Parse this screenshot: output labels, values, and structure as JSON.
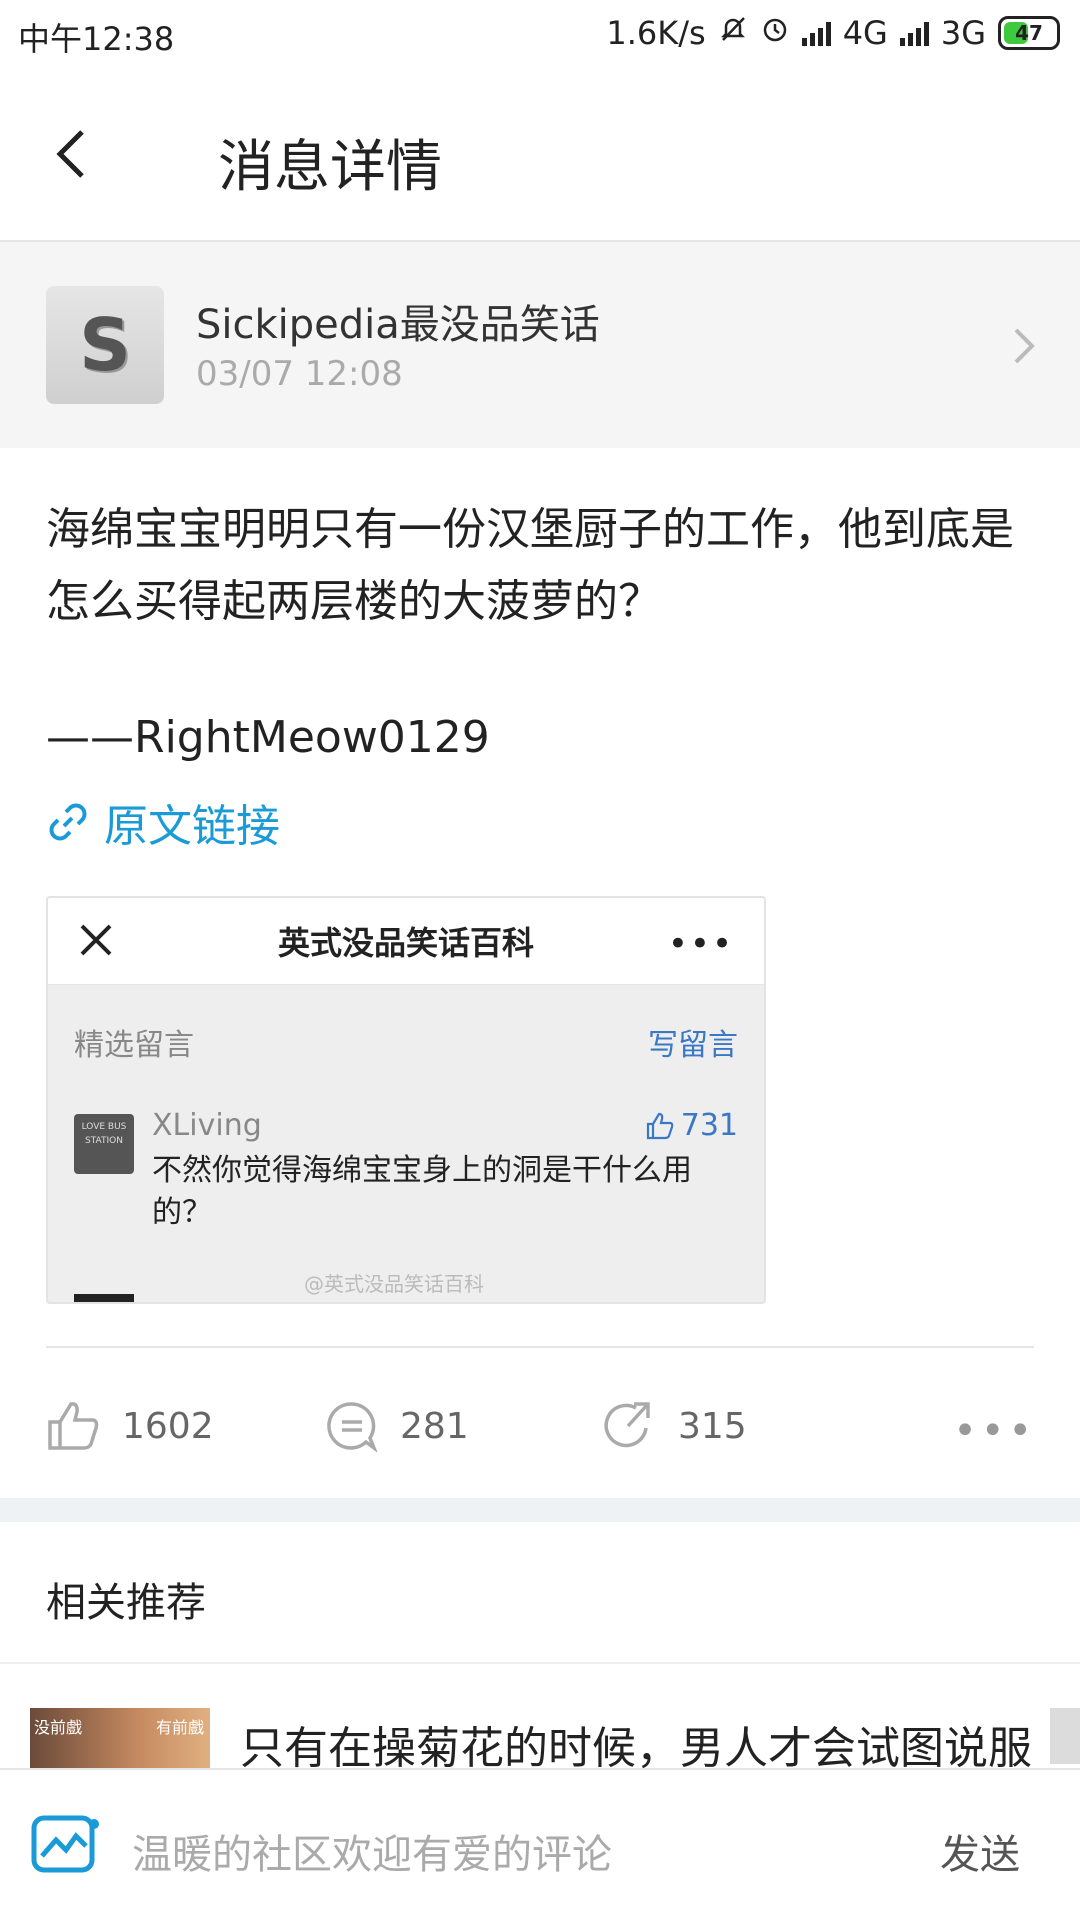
{
  "status_bar": {
    "time": "中午12:38",
    "speed": "1.6K/s",
    "net1": "4G",
    "net2": "3G",
    "battery": "47"
  },
  "header": {
    "title": "消息详情"
  },
  "source": {
    "name": "Sickipedia最没品笑话",
    "time": "03/07 12:08",
    "avatar_letter": "S"
  },
  "post": {
    "text": "海绵宝宝明明只有一份汉堡厨子的工作，他到底是怎么买得起两层楼的大菠萝的？",
    "author": "——RightMeow0129",
    "link_label": "原文链接"
  },
  "card": {
    "title": "英式没品笑话百科",
    "selected_label": "精选留言",
    "write_label": "写留言",
    "comment_user": "XLiving",
    "comment_avatar_text": "LOVE BUS STATION",
    "comment_likes": "731",
    "comment_text": "不然你觉得海绵宝宝身上的洞是干什么用的？",
    "watermark": "@英式没品笑话百科"
  },
  "actions": {
    "likes": "1602",
    "comments": "281",
    "shares": "315"
  },
  "related": {
    "title": "相关推荐",
    "item_text": "只有在操菊花的时候，男人才会试图说服",
    "thumb_left": "没前戲",
    "thumb_right": "有前戲"
  },
  "bottom_bar": {
    "input_placeholder": "温暖的社区欢迎有爱的评论",
    "send_label": "发送"
  },
  "colors": {
    "link": "#1a9bd7",
    "accent_blue": "#3a78c6",
    "battery_green": "#3ec93e"
  }
}
